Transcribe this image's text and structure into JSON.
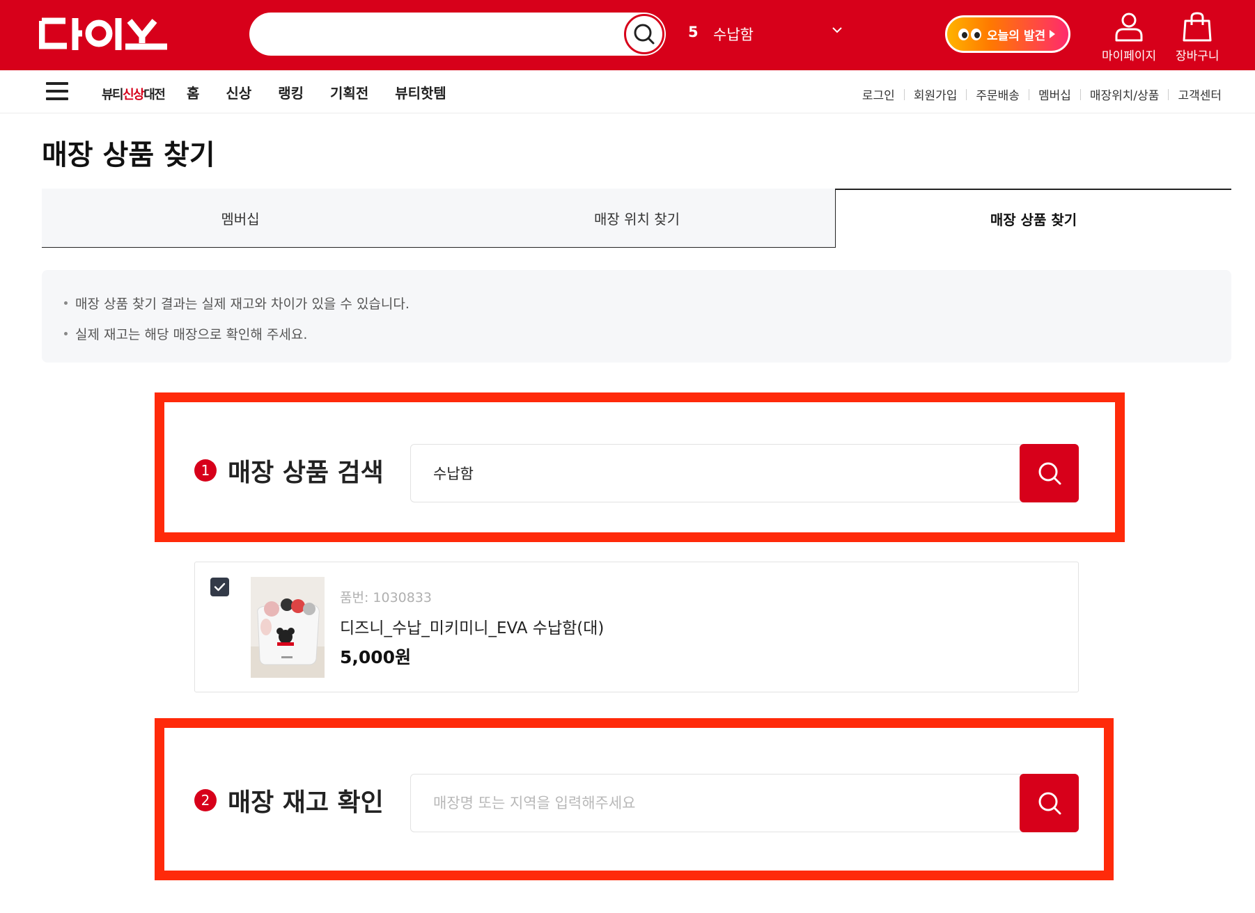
{
  "brand": {
    "logo_text": "다이소",
    "accent_color": "#d7001a",
    "annotation_color": "#ff2a0a"
  },
  "header": {
    "search_icon": "search-icon",
    "trending_rank": "5",
    "trending_term": "수납함",
    "discover_label": "오늘의 발견",
    "mypage_label": "마이페이지",
    "cart_label": "장바구니"
  },
  "nav": {
    "beauty_logo_prefix": "뷰티",
    "beauty_logo_highlight": "신상",
    "beauty_logo_suffix": "대전",
    "items": [
      "홈",
      "신상",
      "랭킹",
      "기획전",
      "뷰티핫템"
    ],
    "util_links": [
      "로그인",
      "회원가입",
      "주문배송",
      "멤버십",
      "매장위치/상품",
      "고객센터"
    ]
  },
  "page": {
    "title": "매장 상품 찾기",
    "tabs": [
      "멤버십",
      "매장 위치 찾기",
      "매장 상품 찾기"
    ],
    "active_tab": "매장 상품 찾기",
    "notices": [
      "매장 상품 찾기 결과는 실제 재고와 차이가 있을 수 있습니다.",
      "실제 재고는 해당 매장으로 확인해 주세요."
    ]
  },
  "product_search": {
    "step": "1",
    "title": "매장 상품 검색",
    "value": "수납함"
  },
  "product": {
    "checked": true,
    "sku_label": "품번: 1030833",
    "name": "디즈니_수납_미키미니_EVA 수납함(대)",
    "price": "5,000원"
  },
  "stock_check": {
    "step": "2",
    "title": "매장 재고 확인",
    "placeholder": "매장명 또는 지역을 입력해주세요"
  }
}
